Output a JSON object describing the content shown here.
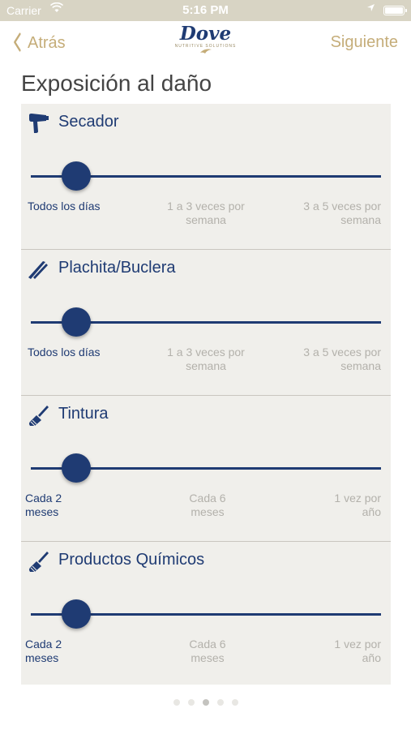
{
  "status_bar": {
    "carrier": "Carrier",
    "time": "5:16 PM",
    "wifi_icon": "wifi-icon",
    "location_icon": "location-arrow-icon",
    "battery_icon": "battery-icon"
  },
  "nav": {
    "back_label": "Atrás",
    "next_label": "Siguiente",
    "logo_brand": "Dove",
    "logo_sub": "NUTRITIVE SOLUTIONS"
  },
  "page_title": "Exposición al daño",
  "sections": [
    {
      "title": "Secador",
      "icon": "hair-dryer-icon",
      "selected_index": 0,
      "options": [
        "Todos los días",
        "1 a 3 veces por semana",
        "3 a 5 veces por semana"
      ]
    },
    {
      "title": "Plachita/Buclera",
      "icon": "hair-straightener-icon",
      "selected_index": 0,
      "options": [
        "Todos los días",
        "1 a 3 veces por semana",
        "3 a 5 veces por semana"
      ]
    },
    {
      "title": "Tintura",
      "icon": "dye-brush-icon",
      "selected_index": 0,
      "options": [
        "Cada 2 meses",
        "Cada 6 meses",
        "1 vez por año"
      ]
    },
    {
      "title": "Productos Químicos",
      "icon": "chemical-brush-icon",
      "selected_index": 0,
      "options": [
        "Cada 2 meses",
        "Cada 6 meses",
        "1 vez por año"
      ]
    }
  ],
  "page_indicator": {
    "total": 5,
    "current": 3
  },
  "colors": {
    "accent_gold": "#c5ad79",
    "navy": "#1f3b73",
    "panel_bg": "#f0efeb",
    "status_bar_bg": "#d8d4c4"
  }
}
